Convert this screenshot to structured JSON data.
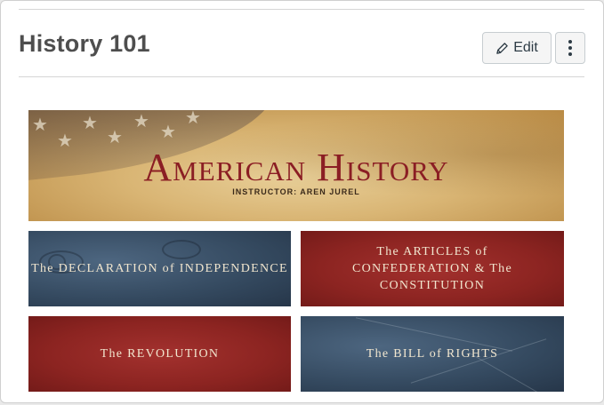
{
  "page": {
    "title": "History 101"
  },
  "toolbar": {
    "edit_label": "Edit",
    "more_icon": "vertical-dots-icon",
    "edit_icon": "pencil-icon"
  },
  "banner": {
    "title": "American History",
    "subtitle": "INSTRUCTOR: AREN JUREL",
    "image": "american-flag-parchment"
  },
  "tiles": [
    {
      "label": "The DECLARATION of INDEPENDENCE",
      "color": "#34495f",
      "image": "dollar-bill-eyes"
    },
    {
      "label": "The ARTICLES of CONFEDERATION & The CONSTITUTION",
      "color": "#8c2421"
    },
    {
      "label": "The REVOLUTION",
      "color": "#8c2421"
    },
    {
      "label": "The BILL of RIGHTS",
      "color": "#34495f",
      "image": "vintage-map"
    }
  ],
  "colors": {
    "title_red": "#8b1e24",
    "tile_blue": "#34495f",
    "tile_red": "#8c2421"
  }
}
